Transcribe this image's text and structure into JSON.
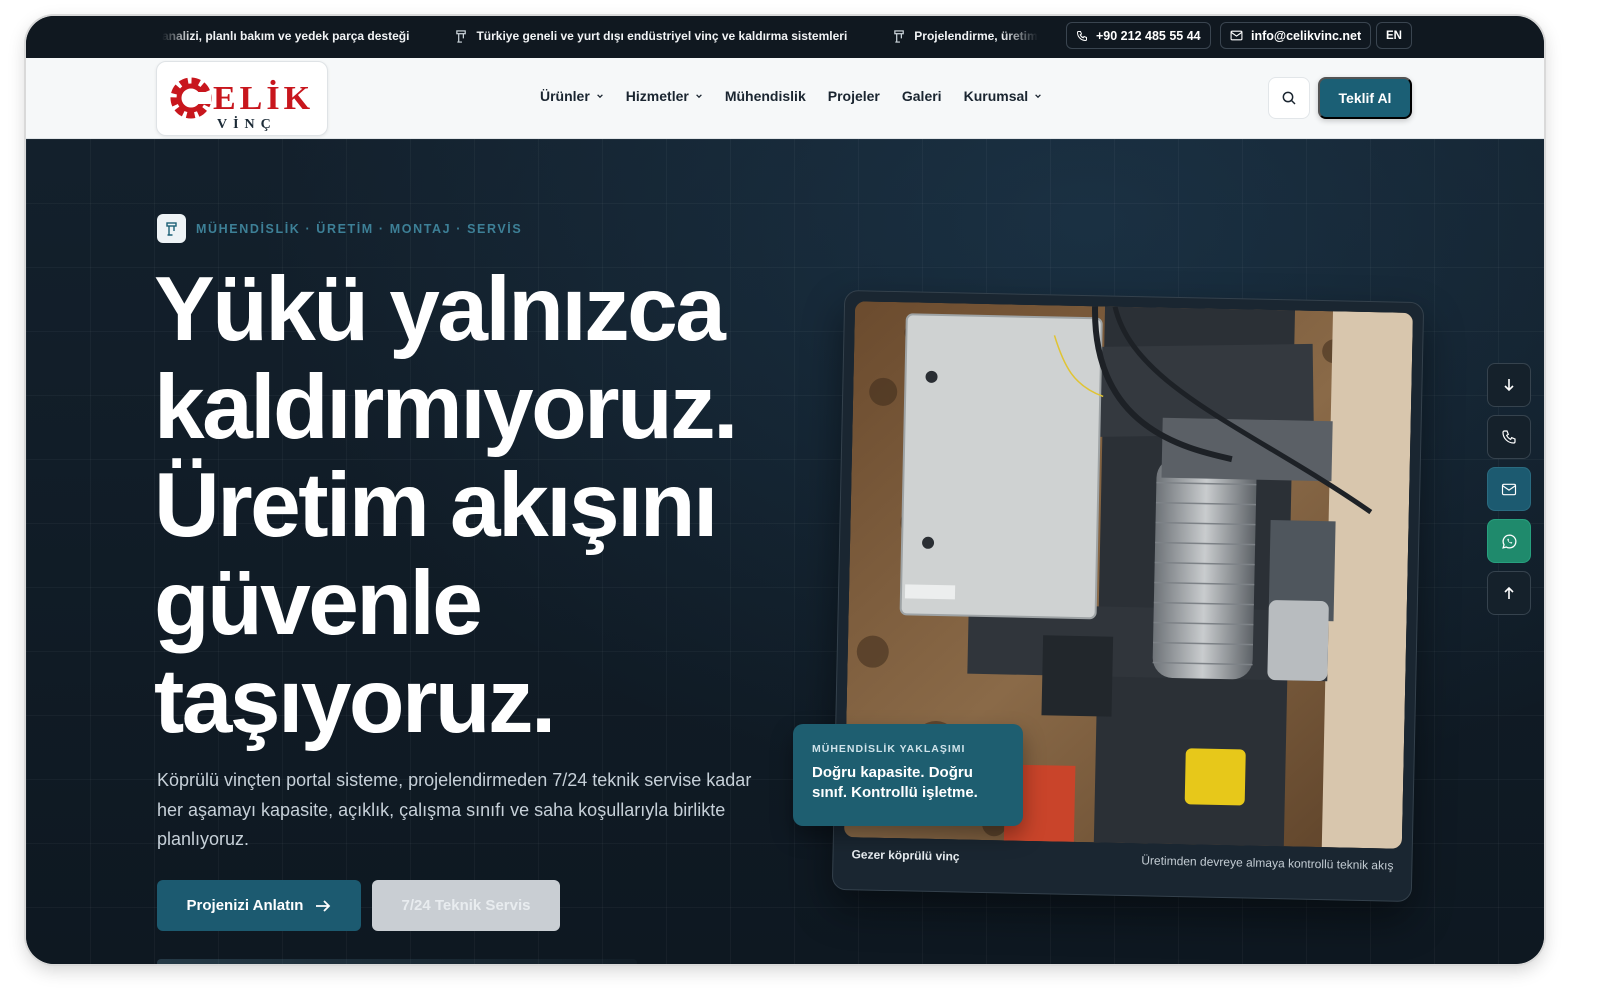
{
  "topbar": {
    "ticker": [
      "analizi, planlı bakım ve yedek parça desteği",
      "Türkiye geneli ve yurt dışı endüstriyel vinç ve kaldırma sistemleri",
      "Projelendirme, üretim, mo"
    ],
    "phone": "+90 212 485 55 44",
    "email": "info@celikvinc.net",
    "lang": "EN"
  },
  "logo": {
    "line1": "ÇELİK",
    "line2": "V İ N Ç"
  },
  "nav": {
    "items": [
      {
        "label": "Ürünler",
        "has_dropdown": true
      },
      {
        "label": "Hizmetler",
        "has_dropdown": true
      },
      {
        "label": "Mühendislik",
        "has_dropdown": false
      },
      {
        "label": "Projeler",
        "has_dropdown": false
      },
      {
        "label": "Galeri",
        "has_dropdown": false
      },
      {
        "label": "Kurumsal",
        "has_dropdown": true
      }
    ],
    "quote_button": "Teklif Al"
  },
  "hero": {
    "eyebrow": "MÜHENDİSLİK · ÜRETİM · MONTAJ · SERVİS",
    "headline": [
      "Yükü yalnızca",
      "kaldırmıyoruz.",
      "Üretim akışını",
      "güvenle",
      "taşıyoruz."
    ],
    "description": "Köprülü vinçten portal sisteme, projelendirmeden 7/24 teknik servise kadar her aşamayı kapasite, açıklık, çalışma sınıfı ve saha koşullarıyla birlikte planlıyoruz.",
    "cta_primary": "Projenizi Anlatın",
    "cta_secondary": "7/24 Teknik Servis"
  },
  "image_card": {
    "caption_left": "Gezer köprülü vinç",
    "caption_right": "Üretimden devreye almaya kontrollü teknik akış"
  },
  "eng_card": {
    "kicker": "MÜHENDİSLİK YAKLAŞIMI",
    "title": "Doğru kapasite. Doğru sınıf. Kontrollü işletme."
  },
  "rail": {
    "items": [
      "arrow-down-icon",
      "phone-icon",
      "mail-icon",
      "whatsapp-icon",
      "arrow-up-icon"
    ]
  },
  "colors": {
    "brand_teal": "#1b5f75",
    "logo_red": "#c8161d",
    "hero_bg": "#0f1a24",
    "whatsapp_green": "#1f8a6c"
  }
}
